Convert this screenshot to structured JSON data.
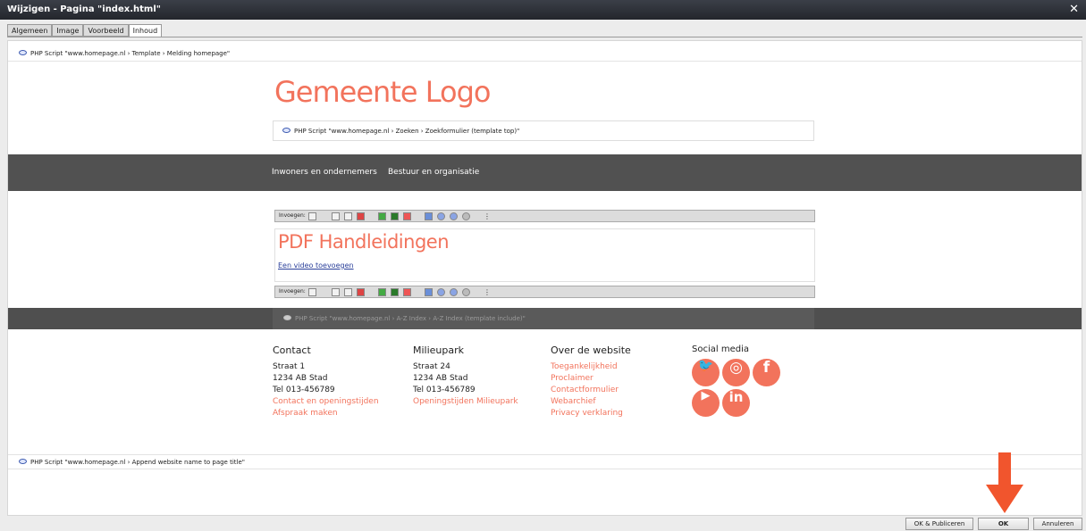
{
  "window": {
    "title": "Wijzigen - Pagina \"index.html\"",
    "close": "✕"
  },
  "tabs": [
    "Algemeen",
    "Image",
    "Voorbeeld",
    "Inhoud"
  ],
  "php": {
    "template": "PHP Script \"www.homepage.nl › Template › Melding homepage\"",
    "search": "PHP Script \"www.homepage.nl ›  Zoeken › Zoekformulier (template top)\"",
    "az_index": "PHP Script \"www.homepage.nl › A-Z Index › A-Z Index (template include)\"",
    "append": "PHP Script \"www.homepage.nl › Append website name to page title\""
  },
  "logo": "Gemeente Logo",
  "nav": [
    "Inwoners en ondernemers",
    "Bestuur en organisatie"
  ],
  "toolbar": {
    "label": "Invoegen:"
  },
  "editor": {
    "heading": "PDF Handleidingen",
    "link": "Een video toevoegen"
  },
  "footer": {
    "contact": {
      "title": "Contact",
      "lines": [
        "Straat 1",
        "1234 AB  Stad",
        "Tel 013-456789"
      ],
      "links": [
        "Contact en openingstijden",
        "Afspraak maken"
      ]
    },
    "milieupark": {
      "title": "Milieupark",
      "lines": [
        "Straat 24",
        "1234 AB  Stad",
        "Tel 013-456789"
      ],
      "links": [
        "Openingstijden Milieupark"
      ]
    },
    "website": {
      "title": "Over de website",
      "links": [
        "Toegankelijkheid",
        "Proclaimer",
        "Contactformulier",
        "Webarchief",
        "Privacy verklaring"
      ]
    },
    "social": {
      "title": "Social media",
      "icons": [
        "twitter-icon",
        "instagram-icon",
        "facebook-icon",
        "youtube-icon",
        "linkedin-icon"
      ],
      "glyphs": [
        "🐦",
        "◎",
        "f",
        "▶",
        "in"
      ]
    }
  },
  "buttons": {
    "ok_publish": "OK & Publiceren",
    "ok": "OK",
    "cancel": "Annuleren"
  },
  "colors": {
    "accent": "#f2735c",
    "nav_bg": "#515151",
    "arrow": "#f1552d"
  }
}
